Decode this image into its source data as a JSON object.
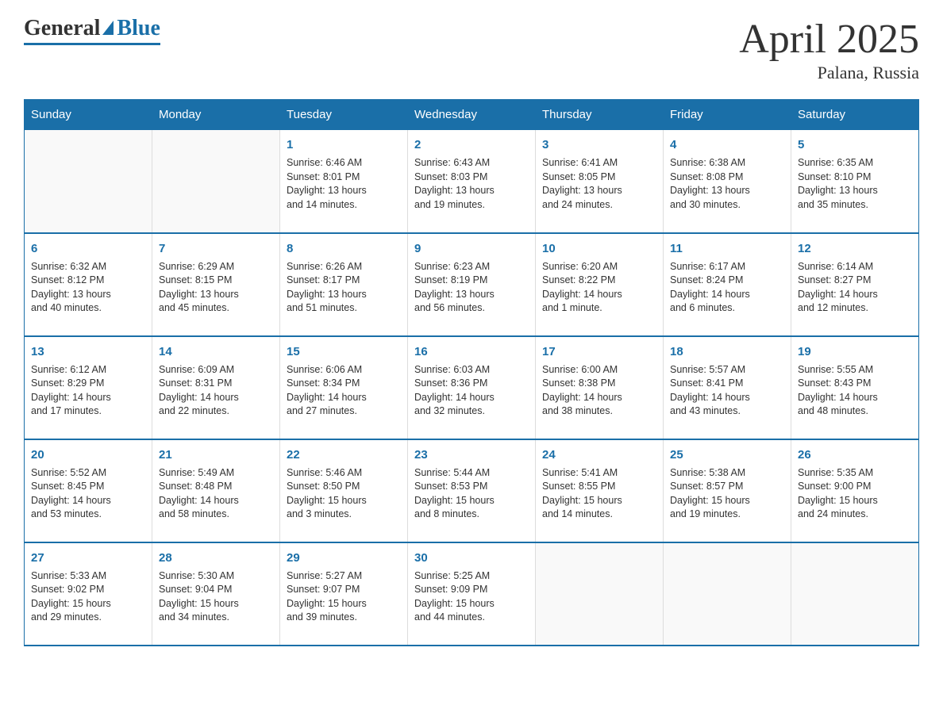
{
  "logo": {
    "general": "General",
    "blue": "Blue"
  },
  "title": "April 2025",
  "subtitle": "Palana, Russia",
  "days_of_week": [
    "Sunday",
    "Monday",
    "Tuesday",
    "Wednesday",
    "Thursday",
    "Friday",
    "Saturday"
  ],
  "weeks": [
    [
      {
        "day": "",
        "info": ""
      },
      {
        "day": "",
        "info": ""
      },
      {
        "day": "1",
        "info": "Sunrise: 6:46 AM\nSunset: 8:01 PM\nDaylight: 13 hours\nand 14 minutes."
      },
      {
        "day": "2",
        "info": "Sunrise: 6:43 AM\nSunset: 8:03 PM\nDaylight: 13 hours\nand 19 minutes."
      },
      {
        "day": "3",
        "info": "Sunrise: 6:41 AM\nSunset: 8:05 PM\nDaylight: 13 hours\nand 24 minutes."
      },
      {
        "day": "4",
        "info": "Sunrise: 6:38 AM\nSunset: 8:08 PM\nDaylight: 13 hours\nand 30 minutes."
      },
      {
        "day": "5",
        "info": "Sunrise: 6:35 AM\nSunset: 8:10 PM\nDaylight: 13 hours\nand 35 minutes."
      }
    ],
    [
      {
        "day": "6",
        "info": "Sunrise: 6:32 AM\nSunset: 8:12 PM\nDaylight: 13 hours\nand 40 minutes."
      },
      {
        "day": "7",
        "info": "Sunrise: 6:29 AM\nSunset: 8:15 PM\nDaylight: 13 hours\nand 45 minutes."
      },
      {
        "day": "8",
        "info": "Sunrise: 6:26 AM\nSunset: 8:17 PM\nDaylight: 13 hours\nand 51 minutes."
      },
      {
        "day": "9",
        "info": "Sunrise: 6:23 AM\nSunset: 8:19 PM\nDaylight: 13 hours\nand 56 minutes."
      },
      {
        "day": "10",
        "info": "Sunrise: 6:20 AM\nSunset: 8:22 PM\nDaylight: 14 hours\nand 1 minute."
      },
      {
        "day": "11",
        "info": "Sunrise: 6:17 AM\nSunset: 8:24 PM\nDaylight: 14 hours\nand 6 minutes."
      },
      {
        "day": "12",
        "info": "Sunrise: 6:14 AM\nSunset: 8:27 PM\nDaylight: 14 hours\nand 12 minutes."
      }
    ],
    [
      {
        "day": "13",
        "info": "Sunrise: 6:12 AM\nSunset: 8:29 PM\nDaylight: 14 hours\nand 17 minutes."
      },
      {
        "day": "14",
        "info": "Sunrise: 6:09 AM\nSunset: 8:31 PM\nDaylight: 14 hours\nand 22 minutes."
      },
      {
        "day": "15",
        "info": "Sunrise: 6:06 AM\nSunset: 8:34 PM\nDaylight: 14 hours\nand 27 minutes."
      },
      {
        "day": "16",
        "info": "Sunrise: 6:03 AM\nSunset: 8:36 PM\nDaylight: 14 hours\nand 32 minutes."
      },
      {
        "day": "17",
        "info": "Sunrise: 6:00 AM\nSunset: 8:38 PM\nDaylight: 14 hours\nand 38 minutes."
      },
      {
        "day": "18",
        "info": "Sunrise: 5:57 AM\nSunset: 8:41 PM\nDaylight: 14 hours\nand 43 minutes."
      },
      {
        "day": "19",
        "info": "Sunrise: 5:55 AM\nSunset: 8:43 PM\nDaylight: 14 hours\nand 48 minutes."
      }
    ],
    [
      {
        "day": "20",
        "info": "Sunrise: 5:52 AM\nSunset: 8:45 PM\nDaylight: 14 hours\nand 53 minutes."
      },
      {
        "day": "21",
        "info": "Sunrise: 5:49 AM\nSunset: 8:48 PM\nDaylight: 14 hours\nand 58 minutes."
      },
      {
        "day": "22",
        "info": "Sunrise: 5:46 AM\nSunset: 8:50 PM\nDaylight: 15 hours\nand 3 minutes."
      },
      {
        "day": "23",
        "info": "Sunrise: 5:44 AM\nSunset: 8:53 PM\nDaylight: 15 hours\nand 8 minutes."
      },
      {
        "day": "24",
        "info": "Sunrise: 5:41 AM\nSunset: 8:55 PM\nDaylight: 15 hours\nand 14 minutes."
      },
      {
        "day": "25",
        "info": "Sunrise: 5:38 AM\nSunset: 8:57 PM\nDaylight: 15 hours\nand 19 minutes."
      },
      {
        "day": "26",
        "info": "Sunrise: 5:35 AM\nSunset: 9:00 PM\nDaylight: 15 hours\nand 24 minutes."
      }
    ],
    [
      {
        "day": "27",
        "info": "Sunrise: 5:33 AM\nSunset: 9:02 PM\nDaylight: 15 hours\nand 29 minutes."
      },
      {
        "day": "28",
        "info": "Sunrise: 5:30 AM\nSunset: 9:04 PM\nDaylight: 15 hours\nand 34 minutes."
      },
      {
        "day": "29",
        "info": "Sunrise: 5:27 AM\nSunset: 9:07 PM\nDaylight: 15 hours\nand 39 minutes."
      },
      {
        "day": "30",
        "info": "Sunrise: 5:25 AM\nSunset: 9:09 PM\nDaylight: 15 hours\nand 44 minutes."
      },
      {
        "day": "",
        "info": ""
      },
      {
        "day": "",
        "info": ""
      },
      {
        "day": "",
        "info": ""
      }
    ]
  ]
}
